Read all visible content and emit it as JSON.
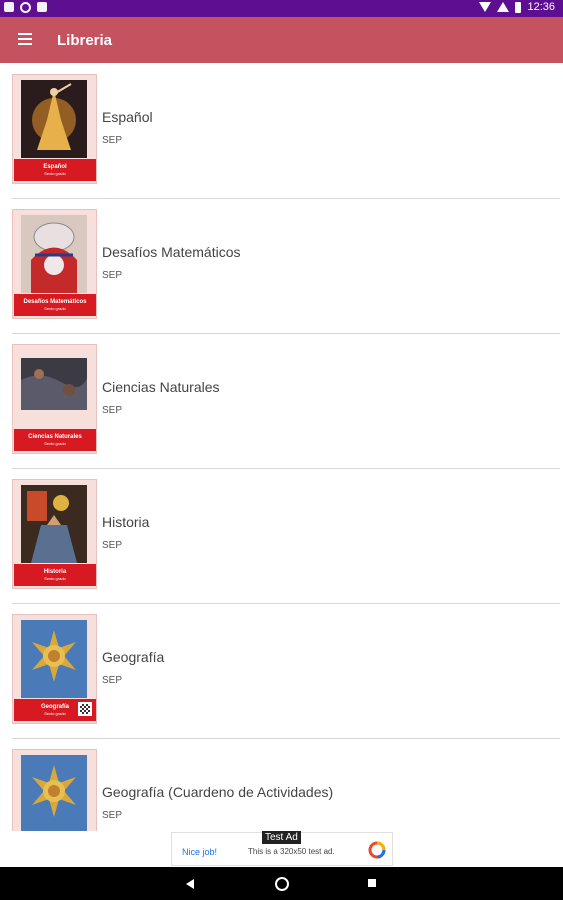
{
  "status_bar": {
    "time": "12:36"
  },
  "app_bar": {
    "title": "Libreria"
  },
  "books": [
    {
      "title": "Español",
      "author": "SEP",
      "cover_title": "Español",
      "cover_subtitle": "Sexto grado"
    },
    {
      "title": "Desafíos Matemáticos",
      "author": "SEP",
      "cover_title": "Desafíos Matemáticos",
      "cover_subtitle": "Sexto grado"
    },
    {
      "title": "Ciencias Naturales",
      "author": "SEP",
      "cover_title": "Ciencias Naturales",
      "cover_subtitle": "Sexto grado"
    },
    {
      "title": "Historia",
      "author": "SEP",
      "cover_title": "Historia",
      "cover_subtitle": "Sexto grado"
    },
    {
      "title": "Geografía",
      "author": "SEP",
      "cover_title": "Geografía",
      "cover_subtitle": "Sexto grado"
    },
    {
      "title": "Geografía (Cuardeno de Actividades)",
      "author": "SEP",
      "cover_title": "",
      "cover_subtitle": ""
    }
  ],
  "ad": {
    "badge": "Test Ad",
    "left_text": "Nice job!",
    "middle_text": "This is a 320x50 test ad."
  },
  "colors": {
    "status_bar": "#5e0f91",
    "app_bar": "#c4525f",
    "cover_band": "#d71a21"
  }
}
